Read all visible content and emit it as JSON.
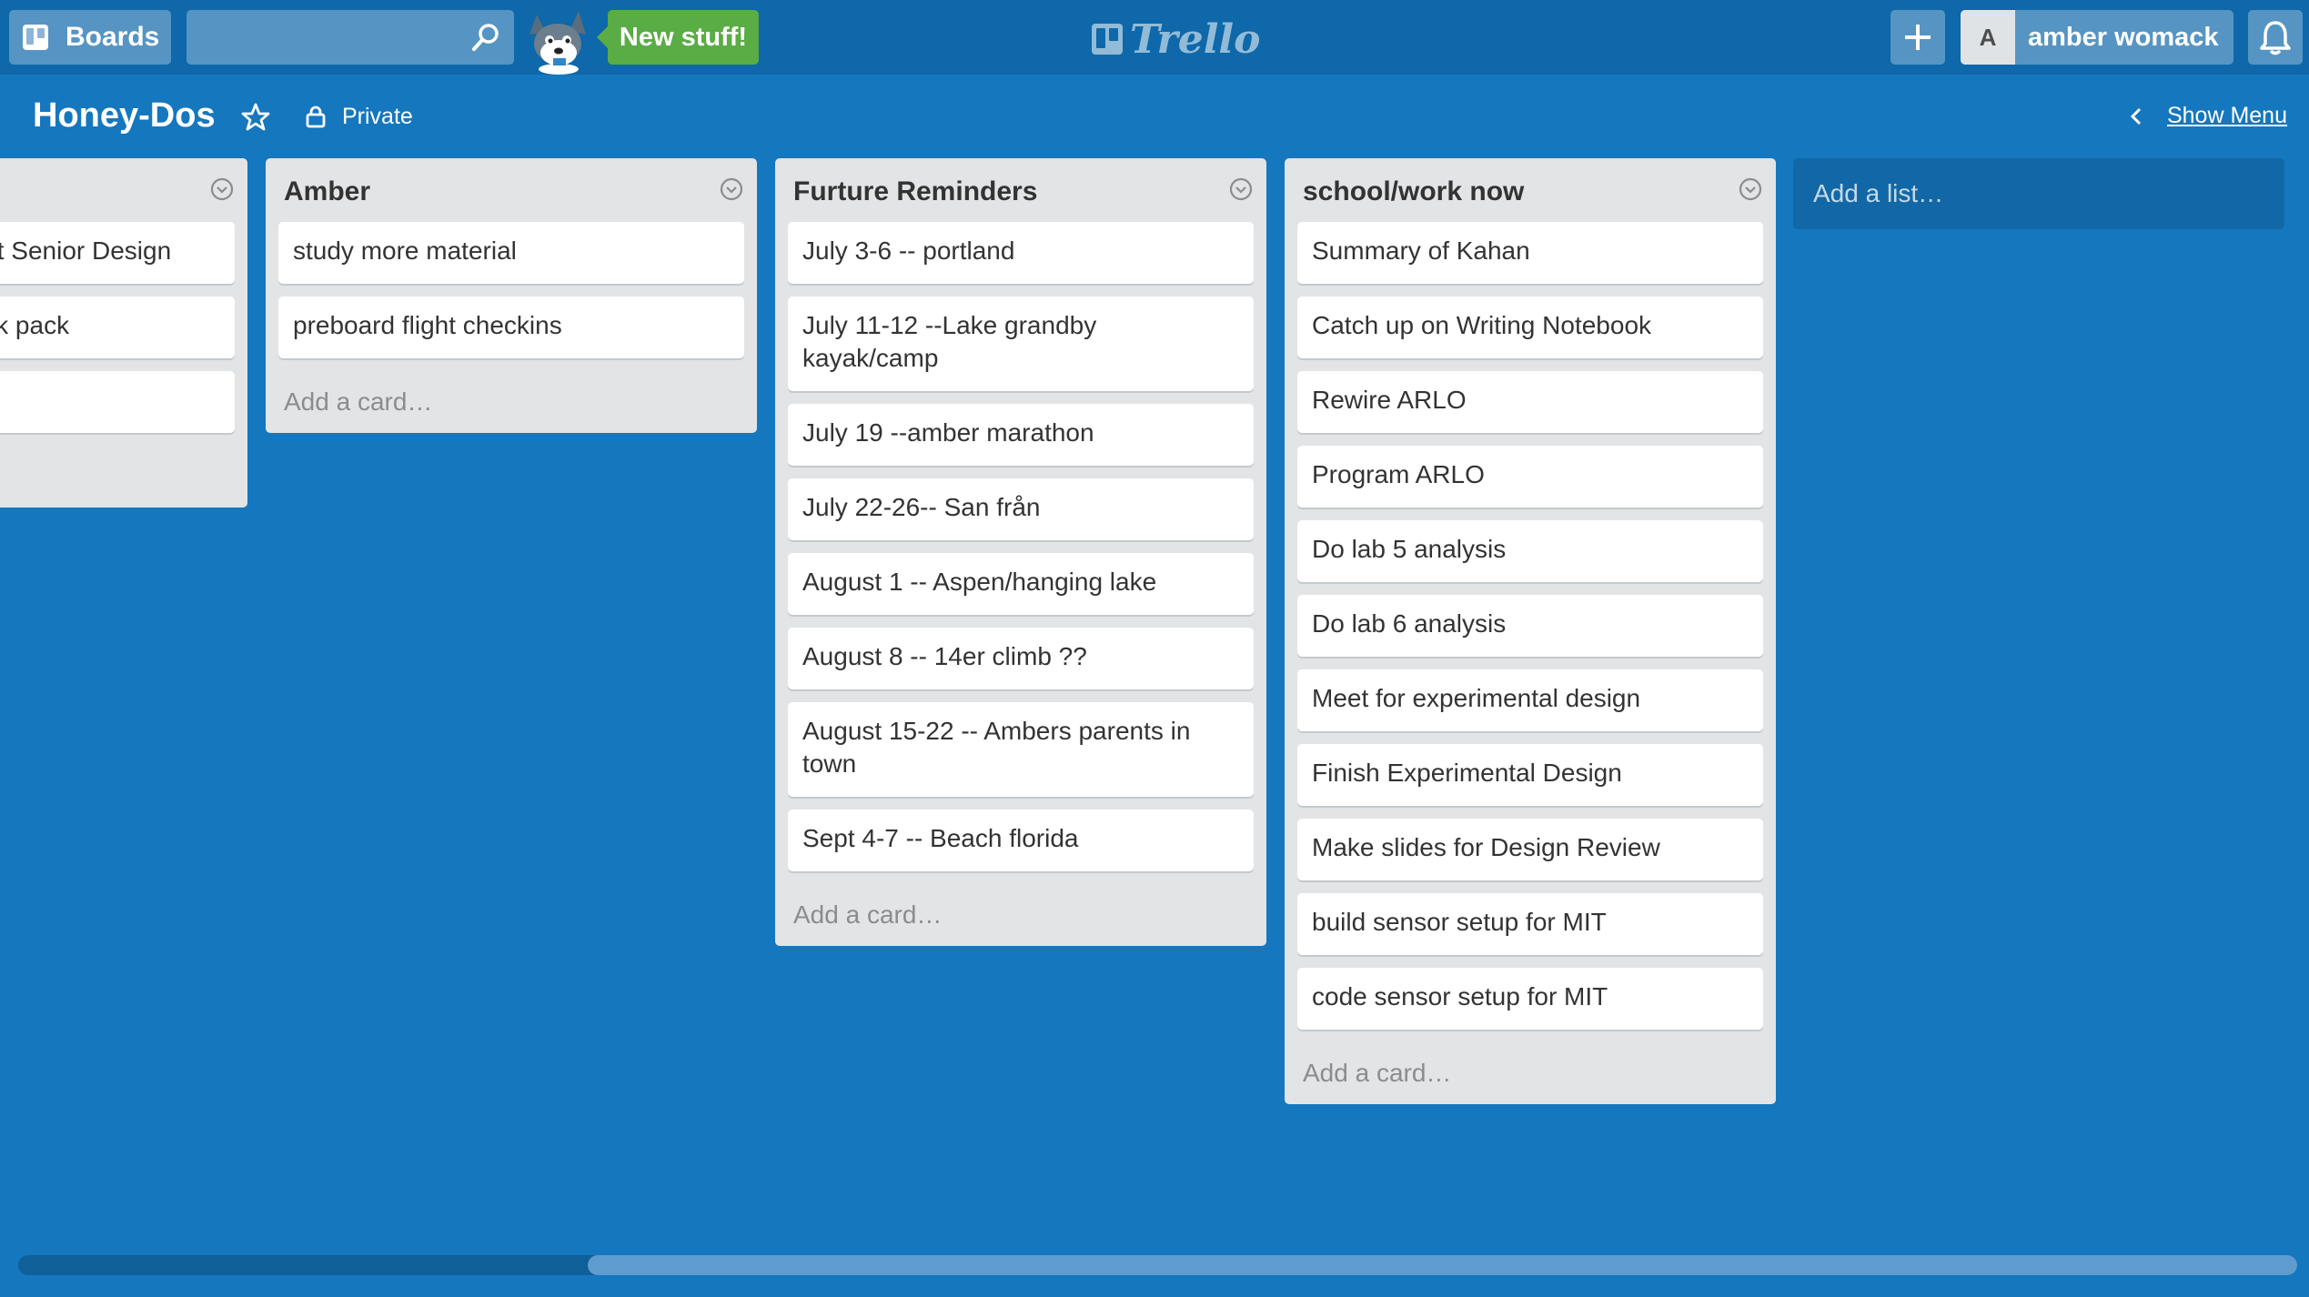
{
  "header": {
    "boards_label": "Boards",
    "new_stuff_label": "New stuff!",
    "logo_text": "Trello",
    "user_initial": "A",
    "user_name": "amber womack"
  },
  "board": {
    "title": "Honey-Dos",
    "visibility": "Private",
    "show_menu": "Show Menu"
  },
  "lists": [
    {
      "title": "",
      "cards": [
        "bout Senior Design",
        "back pack",
        ""
      ]
    },
    {
      "title": "Amber",
      "cards": [
        "study more material",
        "preboard flight checkins"
      ],
      "add_card": "Add a card…"
    },
    {
      "title": "Furture Reminders",
      "cards": [
        "July 3-6 -- portland",
        "July 11-12 --Lake grandby kayak/camp",
        "July 19 --amber marathon",
        "July 22-26-- San från",
        "August 1 -- Aspen/hanging lake",
        "August 8 -- 14er climb ??",
        "August 15-22 -- Ambers parents in town",
        "Sept 4-7 -- Beach florida"
      ],
      "add_card": "Add a card…"
    },
    {
      "title": "school/work now",
      "cards": [
        "Summary of Kahan",
        "Catch up on Writing Notebook",
        "Rewire ARLO",
        "Program ARLO",
        "Do lab 5 analysis",
        "Do lab 6 analysis",
        "Meet for experimental design",
        "Finish Experimental Design",
        "Make slides for Design Review",
        "build sensor setup for MIT",
        "code sensor setup for MIT"
      ],
      "add_card": "Add a card…"
    }
  ],
  "add_list_label": "Add a list…",
  "icons": {
    "boards": "boards-icon",
    "search": "search-icon",
    "add": "plus-icon",
    "notifications": "bell-icon",
    "star": "star-icon",
    "private": "lock-icon",
    "back": "chevron-left-icon",
    "list_menu": "chevron-down-circle-icon"
  },
  "colors": {
    "board_background": "#1577be",
    "header_background": "#0e68a9",
    "new_stuff_green": "#5aac44",
    "list_background": "#e2e4e6"
  }
}
